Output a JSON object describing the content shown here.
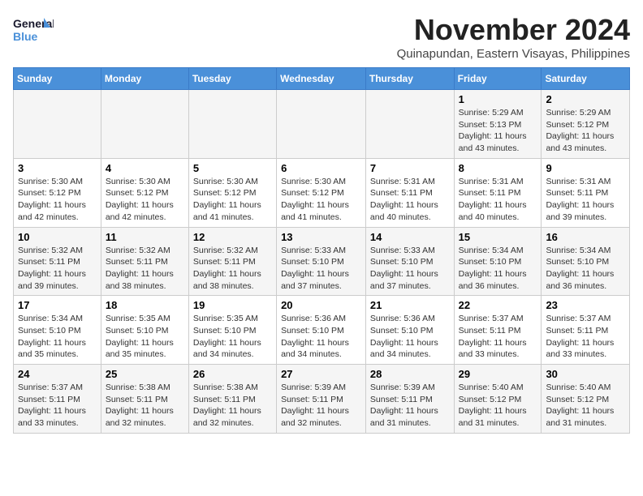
{
  "logo": {
    "line1": "General",
    "line2": "Blue"
  },
  "title": "November 2024",
  "subtitle": "Quinapundan, Eastern Visayas, Philippines",
  "days_of_week": [
    "Sunday",
    "Monday",
    "Tuesday",
    "Wednesday",
    "Thursday",
    "Friday",
    "Saturday"
  ],
  "weeks": [
    [
      {
        "day": "",
        "info": ""
      },
      {
        "day": "",
        "info": ""
      },
      {
        "day": "",
        "info": ""
      },
      {
        "day": "",
        "info": ""
      },
      {
        "day": "",
        "info": ""
      },
      {
        "day": "1",
        "info": "Sunrise: 5:29 AM\nSunset: 5:13 PM\nDaylight: 11 hours and 43 minutes."
      },
      {
        "day": "2",
        "info": "Sunrise: 5:29 AM\nSunset: 5:12 PM\nDaylight: 11 hours and 43 minutes."
      }
    ],
    [
      {
        "day": "3",
        "info": "Sunrise: 5:30 AM\nSunset: 5:12 PM\nDaylight: 11 hours and 42 minutes."
      },
      {
        "day": "4",
        "info": "Sunrise: 5:30 AM\nSunset: 5:12 PM\nDaylight: 11 hours and 42 minutes."
      },
      {
        "day": "5",
        "info": "Sunrise: 5:30 AM\nSunset: 5:12 PM\nDaylight: 11 hours and 41 minutes."
      },
      {
        "day": "6",
        "info": "Sunrise: 5:30 AM\nSunset: 5:12 PM\nDaylight: 11 hours and 41 minutes."
      },
      {
        "day": "7",
        "info": "Sunrise: 5:31 AM\nSunset: 5:11 PM\nDaylight: 11 hours and 40 minutes."
      },
      {
        "day": "8",
        "info": "Sunrise: 5:31 AM\nSunset: 5:11 PM\nDaylight: 11 hours and 40 minutes."
      },
      {
        "day": "9",
        "info": "Sunrise: 5:31 AM\nSunset: 5:11 PM\nDaylight: 11 hours and 39 minutes."
      }
    ],
    [
      {
        "day": "10",
        "info": "Sunrise: 5:32 AM\nSunset: 5:11 PM\nDaylight: 11 hours and 39 minutes."
      },
      {
        "day": "11",
        "info": "Sunrise: 5:32 AM\nSunset: 5:11 PM\nDaylight: 11 hours and 38 minutes."
      },
      {
        "day": "12",
        "info": "Sunrise: 5:32 AM\nSunset: 5:11 PM\nDaylight: 11 hours and 38 minutes."
      },
      {
        "day": "13",
        "info": "Sunrise: 5:33 AM\nSunset: 5:10 PM\nDaylight: 11 hours and 37 minutes."
      },
      {
        "day": "14",
        "info": "Sunrise: 5:33 AM\nSunset: 5:10 PM\nDaylight: 11 hours and 37 minutes."
      },
      {
        "day": "15",
        "info": "Sunrise: 5:34 AM\nSunset: 5:10 PM\nDaylight: 11 hours and 36 minutes."
      },
      {
        "day": "16",
        "info": "Sunrise: 5:34 AM\nSunset: 5:10 PM\nDaylight: 11 hours and 36 minutes."
      }
    ],
    [
      {
        "day": "17",
        "info": "Sunrise: 5:34 AM\nSunset: 5:10 PM\nDaylight: 11 hours and 35 minutes."
      },
      {
        "day": "18",
        "info": "Sunrise: 5:35 AM\nSunset: 5:10 PM\nDaylight: 11 hours and 35 minutes."
      },
      {
        "day": "19",
        "info": "Sunrise: 5:35 AM\nSunset: 5:10 PM\nDaylight: 11 hours and 34 minutes."
      },
      {
        "day": "20",
        "info": "Sunrise: 5:36 AM\nSunset: 5:10 PM\nDaylight: 11 hours and 34 minutes."
      },
      {
        "day": "21",
        "info": "Sunrise: 5:36 AM\nSunset: 5:10 PM\nDaylight: 11 hours and 34 minutes."
      },
      {
        "day": "22",
        "info": "Sunrise: 5:37 AM\nSunset: 5:11 PM\nDaylight: 11 hours and 33 minutes."
      },
      {
        "day": "23",
        "info": "Sunrise: 5:37 AM\nSunset: 5:11 PM\nDaylight: 11 hours and 33 minutes."
      }
    ],
    [
      {
        "day": "24",
        "info": "Sunrise: 5:37 AM\nSunset: 5:11 PM\nDaylight: 11 hours and 33 minutes."
      },
      {
        "day": "25",
        "info": "Sunrise: 5:38 AM\nSunset: 5:11 PM\nDaylight: 11 hours and 32 minutes."
      },
      {
        "day": "26",
        "info": "Sunrise: 5:38 AM\nSunset: 5:11 PM\nDaylight: 11 hours and 32 minutes."
      },
      {
        "day": "27",
        "info": "Sunrise: 5:39 AM\nSunset: 5:11 PM\nDaylight: 11 hours and 32 minutes."
      },
      {
        "day": "28",
        "info": "Sunrise: 5:39 AM\nSunset: 5:11 PM\nDaylight: 11 hours and 31 minutes."
      },
      {
        "day": "29",
        "info": "Sunrise: 5:40 AM\nSunset: 5:12 PM\nDaylight: 11 hours and 31 minutes."
      },
      {
        "day": "30",
        "info": "Sunrise: 5:40 AM\nSunset: 5:12 PM\nDaylight: 11 hours and 31 minutes."
      }
    ]
  ]
}
